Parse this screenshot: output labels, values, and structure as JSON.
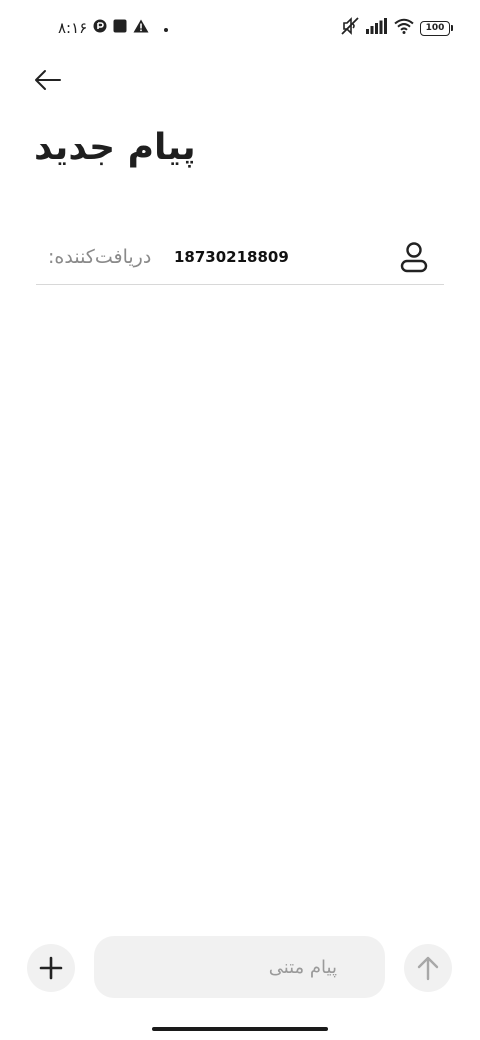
{
  "status_bar": {
    "time": "۸:۱۶",
    "left_icons": [
      "vpn-key-icon",
      "stop-square-icon",
      "warning-icon",
      "dot-icon"
    ],
    "right_icons": [
      "mute-icon",
      "signal-icon",
      "wifi-icon"
    ],
    "battery": "100"
  },
  "header": {
    "back_icon": "arrow-left-icon",
    "title": "پیام جدید"
  },
  "recipient": {
    "label": "دریافت‌کننده:",
    "value": "18730218809",
    "contact_icon": "person-icon"
  },
  "composer": {
    "add_icon": "plus-icon",
    "placeholder": "پیام متنی",
    "value": "",
    "send_icon": "arrow-up-icon"
  },
  "colors": {
    "background": "#ffffff",
    "text": "#1a1a1a",
    "muted": "#8a8a8a",
    "field_bg": "#f1f1f1",
    "divider": "#d8d8d8"
  }
}
